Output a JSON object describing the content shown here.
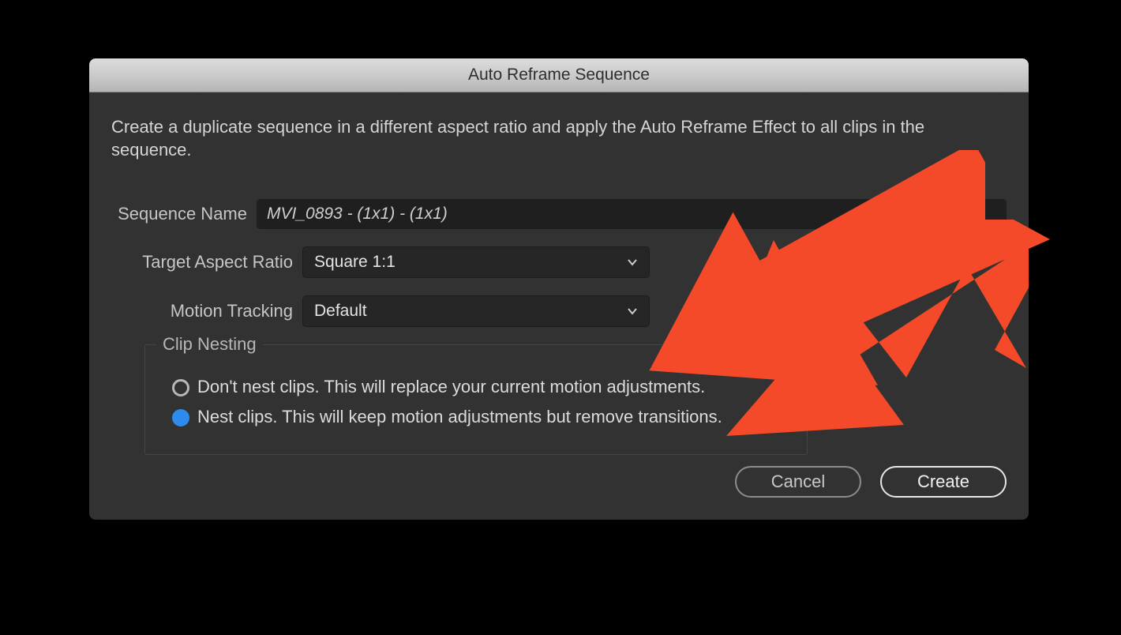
{
  "dialog": {
    "title": "Auto Reframe Sequence",
    "description": "Create a duplicate sequence in a different aspect ratio and apply the Auto Reframe Effect to all clips in the sequence.",
    "sequence_name_label": "Sequence Name",
    "sequence_name_value": "MVI_0893 - (1x1) - (1x1)",
    "aspect_ratio_label": "Target Aspect Ratio",
    "aspect_ratio_value": "Square 1:1",
    "motion_tracking_label": "Motion Tracking",
    "motion_tracking_value": "Default",
    "clip_nesting_legend": "Clip Nesting",
    "clip_nesting_options": {
      "dont_nest": "Don't nest clips. This will replace your current motion adjustments.",
      "nest": "Nest clips. This will keep motion adjustments but remove transitions."
    },
    "clip_nesting_selected": "nest",
    "cancel_label": "Cancel",
    "create_label": "Create"
  },
  "annotation": {
    "color": "#f44a29",
    "target": "clip-nesting-group"
  }
}
